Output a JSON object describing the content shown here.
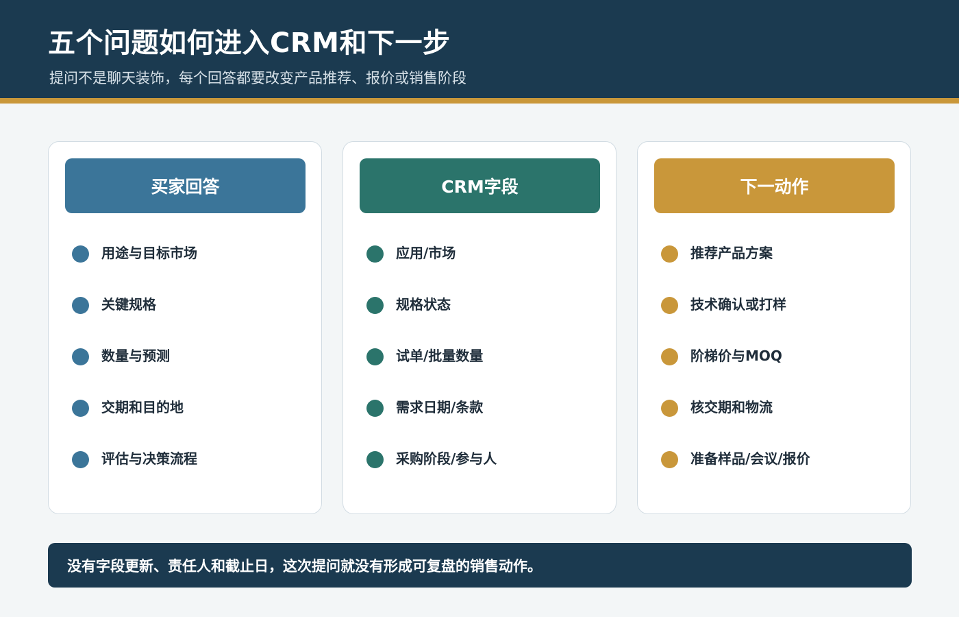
{
  "header": {
    "title": "五个问题如何进入CRM和下一步",
    "subtitle": "提问不是聊天装饰，每个回答都要改变产品推荐、报价或销售阶段"
  },
  "columns": [
    {
      "title": "买家回答",
      "color": "#3b7599",
      "items": [
        "用途与目标市场",
        "关键规格",
        "数量与预测",
        "交期和目的地",
        "评估与决策流程"
      ]
    },
    {
      "title": "CRM字段",
      "color": "#2b746b",
      "items": [
        "应用/市场",
        "规格状态",
        "试单/批量数量",
        "需求日期/条款",
        "采购阶段/参与人"
      ]
    },
    {
      "title": "下一动作",
      "color": "#c9973a",
      "items": [
        "推荐产品方案",
        "技术确认或打样",
        "阶梯价与MOQ",
        "核交期和物流",
        "准备样品/会议/报价"
      ]
    }
  ],
  "footer": {
    "text": "没有字段更新、责任人和截止日，这次提问就没有形成可复盘的销售动作。"
  },
  "colors": {
    "header_bg": "#1b3a50",
    "accent_stripe": "#c9973a",
    "page_bg": "#f3f6f7"
  }
}
